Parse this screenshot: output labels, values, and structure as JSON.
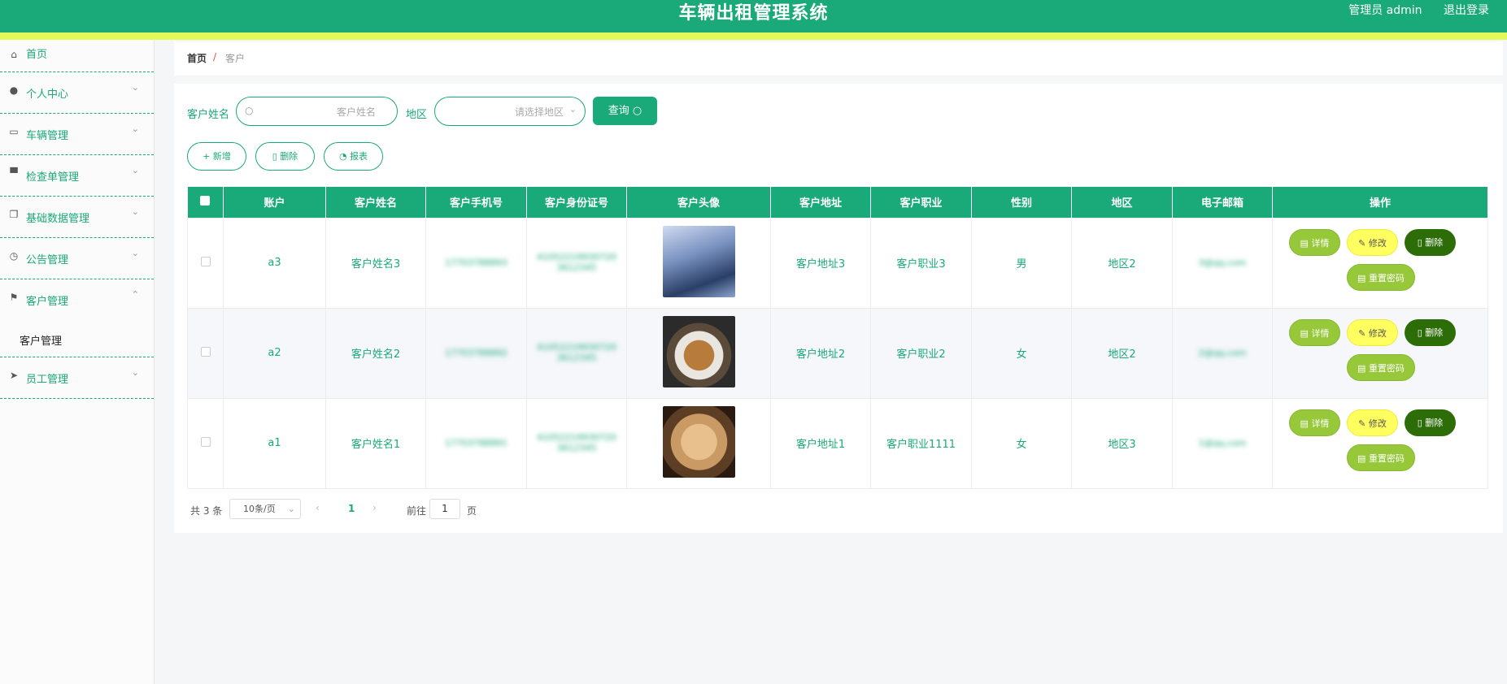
{
  "header": {
    "title": "车辆出租管理系统",
    "role": "管理员 admin",
    "logout": "退出登录"
  },
  "sidebar": {
    "items": [
      {
        "label": "首页",
        "icon": "home-icon"
      },
      {
        "label": "个人中心",
        "icon": "user-icon"
      },
      {
        "label": "车辆管理",
        "icon": "card-icon"
      },
      {
        "label": "检查单管理",
        "icon": "monitor-icon"
      },
      {
        "label": "基础数据管理",
        "icon": "copy-icon"
      },
      {
        "label": "公告管理",
        "icon": "clock-icon"
      },
      {
        "label": "客户管理",
        "icon": "flag-icon",
        "sub": "客户管理"
      },
      {
        "label": "员工管理",
        "icon": "send-icon"
      }
    ]
  },
  "breadcrumb": {
    "home": "首页",
    "sep": "/",
    "current": "客户"
  },
  "search": {
    "name_label": "客户姓名",
    "name_placeholder": "客户姓名",
    "region_label": "地区",
    "region_placeholder": "请选择地区",
    "query_label": "查询"
  },
  "actions": {
    "add": "新增",
    "delete": "删除",
    "report": "报表"
  },
  "table": {
    "columns": [
      "账户",
      "客户姓名",
      "客户手机号",
      "客户身份证号",
      "客户头像",
      "客户地址",
      "客户职业",
      "性别",
      "地区",
      "电子邮箱",
      "操作"
    ],
    "rows": [
      {
        "account": "a3",
        "name": "客户姓名3",
        "phone": "17703788893",
        "idcard": "410522199307203612345",
        "address": "客户地址3",
        "job": "客户职业3",
        "gender": "男",
        "region": "地区2",
        "email": "3@qq.com"
      },
      {
        "account": "a2",
        "name": "客户姓名2",
        "phone": "17703788892",
        "idcard": "410522199307203612345",
        "address": "客户地址2",
        "job": "客户职业2",
        "gender": "女",
        "region": "地区2",
        "email": "2@qq.com"
      },
      {
        "account": "a1",
        "name": "客户姓名1",
        "phone": "17703788891",
        "idcard": "410522199307203612345",
        "address": "客户地址1",
        "job": "客户职业1111",
        "gender": "女",
        "region": "地区3",
        "email": "1@qq.com"
      }
    ],
    "ops": {
      "detail": "详情",
      "edit": "修改",
      "delete": "删除",
      "reset": "重置密码"
    }
  },
  "pager": {
    "total": "共 3 条",
    "size": "10条/页",
    "page": "1",
    "goto": "前往",
    "goto_value": "1",
    "page_unit": "页"
  },
  "colors": {
    "primary": "#1aa978",
    "accent_bar": "#e3f95a"
  }
}
